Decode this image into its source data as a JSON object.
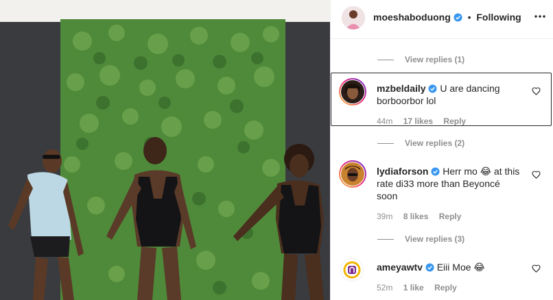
{
  "header": {
    "username": "moeshaboduong",
    "separator": "•",
    "follow_state": "Following"
  },
  "threads": [
    {
      "view_replies": "View replies (1)"
    },
    {
      "view_replies": "View replies (2)"
    },
    {
      "view_replies": "View replies (3)"
    }
  ],
  "comments": [
    {
      "username": "mzbeldaily",
      "text_line1": "U are dancing",
      "text_line2": "borboorbor lol",
      "time": "44m",
      "likes": "17 likes",
      "reply": "Reply"
    },
    {
      "username": "lydiaforson",
      "text_line1": "Herr mo 😂 at this",
      "text_line2": "rate di33 more than Beyoncé",
      "text_line3": "soon",
      "time": "39m",
      "likes": "8 likes",
      "reply": "Reply"
    },
    {
      "username": "ameyawtv",
      "text_line1": "Eiii Moe 😂",
      "time": "52m",
      "likes": "1 like",
      "reply": "Reply"
    }
  ],
  "colors": {
    "text_primary": "#262626",
    "text_secondary": "#8e8e8e",
    "verified_blue": "#3897f0",
    "wall_green": "#4f8a3a"
  },
  "icons": [
    "verified-badge-icon",
    "more-options-icon",
    "heart-icon"
  ]
}
